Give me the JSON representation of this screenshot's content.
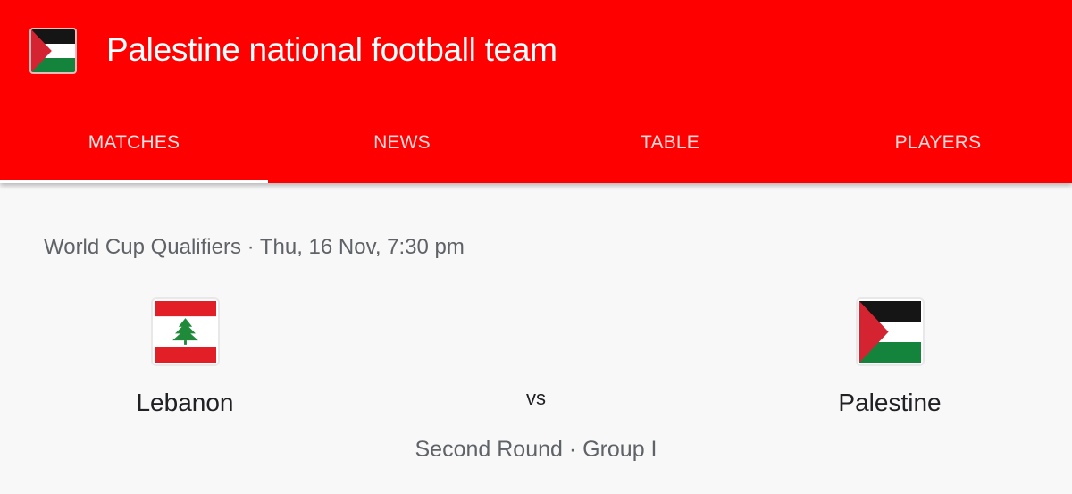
{
  "header": {
    "title": "Palestine national football team",
    "flag_icon": "palestine-flag",
    "background": "#ff0000"
  },
  "tabs": [
    {
      "label": "MATCHES",
      "active": true
    },
    {
      "label": "NEWS",
      "active": false
    },
    {
      "label": "TABLE",
      "active": false
    },
    {
      "label": "PLAYERS",
      "active": false
    }
  ],
  "match": {
    "competition_line": "World Cup Qualifiers · Thu, 16 Nov, 7:30 pm",
    "home": {
      "name": "Lebanon",
      "flag_icon": "lebanon-flag"
    },
    "away": {
      "name": "Palestine",
      "flag_icon": "palestine-flag"
    },
    "vs_label": "vs",
    "round": "Second Round · Group I"
  }
}
